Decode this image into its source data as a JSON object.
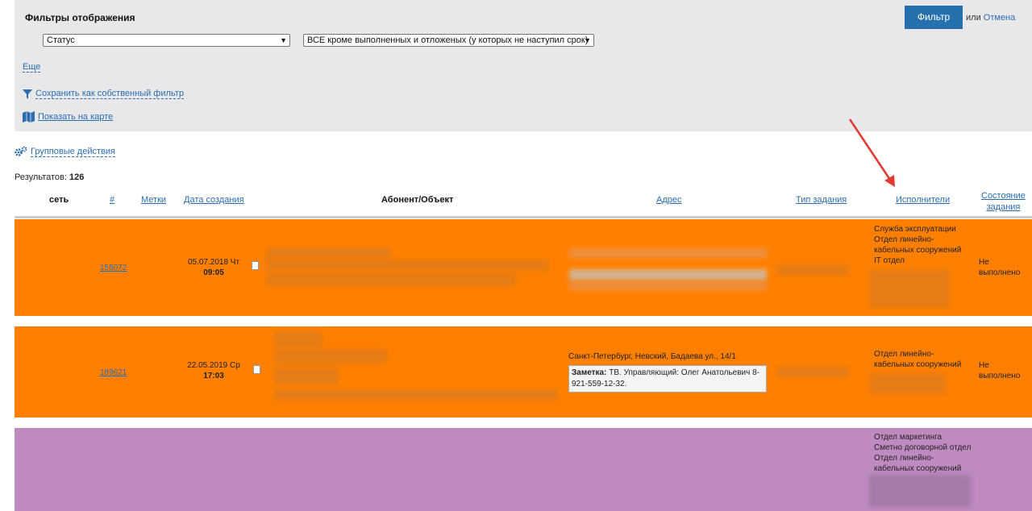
{
  "filters": {
    "title": "Фильтры отображения",
    "field_select": "Статус",
    "value_select": "ВСЕ кроме выполненных и отложеных (у которых не наступил срок)",
    "filter_button": "Фильтр",
    "or_text": "или",
    "cancel_link": "Отмена",
    "more_link": "Еще",
    "save_filter_link": "Сохранить как собственный фильтр",
    "show_map_link": "Показать на карте"
  },
  "group_actions": "Групповые действия",
  "results": {
    "label": "Результатов:",
    "count": "126"
  },
  "columns": {
    "network": "сеть",
    "number": "#",
    "tags": "Метки",
    "created": "Дата создания",
    "subscriber": "Абонент/Объект",
    "address": "Адрес",
    "task_type": "Тип задания",
    "executors": "Исполнители",
    "state_line1": "Состояние",
    "state_line2": "задания"
  },
  "rows": [
    {
      "color": "#ff8000",
      "number": "155072",
      "date": "05.07.2018 Чт",
      "time": "09:05",
      "executors": [
        "Служба эксплуатации",
        "Отдел линейно-",
        "кабельных сооружений",
        "IT отдел"
      ],
      "state_line1": "Не",
      "state_line2": "выполнено"
    },
    {
      "color": "#ff8000",
      "number": "189621",
      "date": "22.05.2019 Ср",
      "time": "17:03",
      "address": "Санкт-Петербург, Невский, Бадаева ул., 14/1",
      "note_label": "Заметка:",
      "note_text": "ТВ. Управляющий: Олег Анатольевич 8-921-559-12-32.",
      "executors": [
        "Отдел линейно-",
        "кабельных сооружений"
      ],
      "state_line1": "Не",
      "state_line2": "выполнено"
    },
    {
      "color": "#be8abf",
      "executors": [
        "Отдел маркетинга",
        "Сметно договорной отдел",
        "Отдел линейно-",
        "кабельных сооружений"
      ]
    }
  ]
}
